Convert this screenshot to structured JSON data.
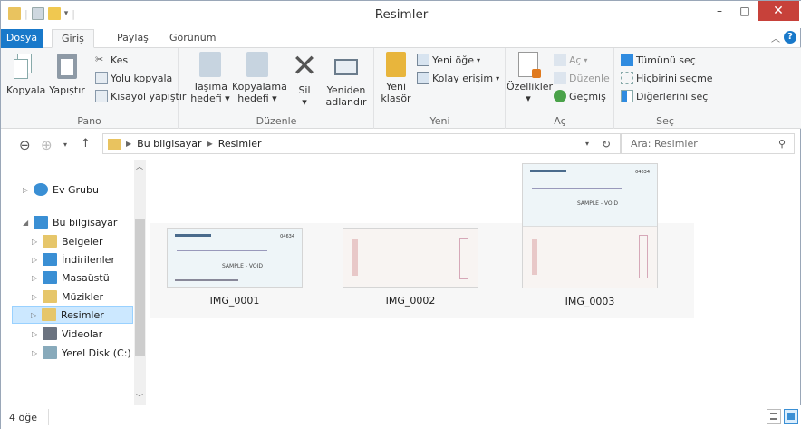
{
  "window": {
    "title": "Resimler",
    "minimize": "–",
    "maximize": "□",
    "close": "✕"
  },
  "tabs": {
    "file": "Dosya",
    "home": "Giriş",
    "share": "Paylaş",
    "view": "Görünüm"
  },
  "ribbon": {
    "pano": {
      "label": "Pano",
      "copy": "Kopyala",
      "paste": "Yapıştır",
      "cut": "Kes",
      "copy_path": "Yolu kopyala",
      "paste_shortcut": "Kısayol yapıştır"
    },
    "duzenle": {
      "label": "Düzenle",
      "move_to_1": "Taşıma",
      "move_to_2": "hedefi",
      "copy_to_1": "Kopyalama",
      "copy_to_2": "hedefi",
      "delete": "Sil",
      "rename_1": "Yeniden",
      "rename_2": "adlandır"
    },
    "yeni": {
      "label": "Yeni",
      "new_folder_1": "Yeni",
      "new_folder_2": "klasör",
      "new_item": "Yeni öğe",
      "easy_access": "Kolay erişim"
    },
    "ac": {
      "label": "Aç",
      "properties": "Özellikler",
      "open": "Aç",
      "edit": "Düzenle",
      "history": "Geçmiş"
    },
    "sec": {
      "label": "Seç",
      "select_all": "Tümünü seç",
      "select_none": "Hiçbirini seçme",
      "invert": "Diğerlerini seç"
    }
  },
  "address": {
    "crumbs": [
      "Bu bilgisayar",
      "Resimler"
    ],
    "search_placeholder": "Ara: Resimler"
  },
  "nav": {
    "homegroup": "Ev Grubu",
    "this_pc": "Bu bilgisayar",
    "items": [
      "Belgeler",
      "İndirilenler",
      "Masaüstü",
      "Müzikler",
      "Resimler",
      "Videolar",
      "Yerel Disk (C:)"
    ]
  },
  "files": [
    {
      "name": "IMG_0001"
    },
    {
      "name": "IMG_0002"
    },
    {
      "name": "IMG_0003"
    }
  ],
  "check_text": {
    "void": "SAMPLE - VOID",
    "number": "04634"
  },
  "status": {
    "count": "4 öğe"
  },
  "colors": {
    "accent": "#1979ca",
    "selection": "#cce8ff",
    "close": "#c7413a"
  }
}
